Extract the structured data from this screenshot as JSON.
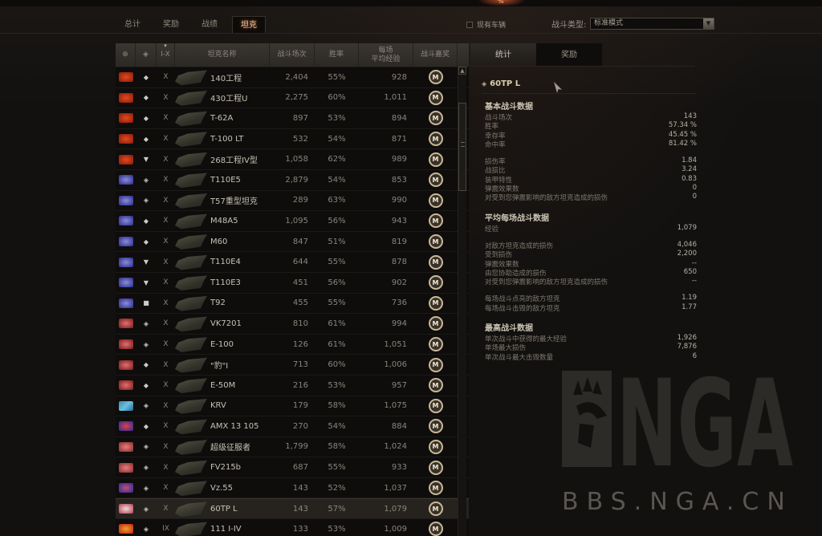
{
  "header": {
    "top_indicator": "%"
  },
  "main_tabs": [
    {
      "label": "总计",
      "active": false
    },
    {
      "label": "奖励",
      "active": false
    },
    {
      "label": "战绩",
      "active": false
    },
    {
      "label": "坦克",
      "active": true
    }
  ],
  "filters": {
    "owned_vehicles_label": "现有车辆",
    "owned_vehicles_checked": false,
    "battle_type_label": "战斗类型:",
    "battle_type_value": "标准模式"
  },
  "table": {
    "columns": {
      "nation": "nation-icon",
      "type": "type-icon",
      "tier": "I-X",
      "name": "坦克名称",
      "battles": "战斗场次",
      "win_rate": "胜率",
      "avg_xp_line1": "每场",
      "avg_xp_line2": "平均经验",
      "medal": "战斗嘉奖"
    },
    "rows": [
      {
        "nation": "ussr",
        "type": "◆",
        "tier": "X",
        "name": "140工程",
        "battles": "2,404",
        "win_rate": "55%",
        "avg_xp": "928",
        "medal": "M"
      },
      {
        "nation": "ussr",
        "type": "◆",
        "tier": "X",
        "name": "430工程U",
        "battles": "2,275",
        "win_rate": "60%",
        "avg_xp": "1,011",
        "medal": "M"
      },
      {
        "nation": "ussr",
        "type": "◆",
        "tier": "X",
        "name": "T-62A",
        "battles": "897",
        "win_rate": "53%",
        "avg_xp": "894",
        "medal": "M"
      },
      {
        "nation": "ussr",
        "type": "◆",
        "tier": "X",
        "name": "T-100 LT",
        "battles": "532",
        "win_rate": "54%",
        "avg_xp": "871",
        "medal": "M"
      },
      {
        "nation": "ussr",
        "type": "▼",
        "tier": "X",
        "name": "268工程IV型",
        "battles": "1,058",
        "win_rate": "62%",
        "avg_xp": "989",
        "medal": "M"
      },
      {
        "nation": "usa",
        "type": "◈",
        "tier": "X",
        "name": "T110E5",
        "battles": "2,879",
        "win_rate": "54%",
        "avg_xp": "853",
        "medal": "M"
      },
      {
        "nation": "usa",
        "type": "◈",
        "tier": "X",
        "name": "T57重型坦克",
        "battles": "289",
        "win_rate": "63%",
        "avg_xp": "990",
        "medal": "M"
      },
      {
        "nation": "usa",
        "type": "◆",
        "tier": "X",
        "name": "M48A5",
        "battles": "1,095",
        "win_rate": "56%",
        "avg_xp": "943",
        "medal": "M"
      },
      {
        "nation": "usa",
        "type": "◆",
        "tier": "X",
        "name": "M60",
        "battles": "847",
        "win_rate": "51%",
        "avg_xp": "819",
        "medal": "M"
      },
      {
        "nation": "usa",
        "type": "▼",
        "tier": "X",
        "name": "T110E4",
        "battles": "644",
        "win_rate": "55%",
        "avg_xp": "878",
        "medal": "M"
      },
      {
        "nation": "usa",
        "type": "▼",
        "tier": "X",
        "name": "T110E3",
        "battles": "451",
        "win_rate": "56%",
        "avg_xp": "902",
        "medal": "M"
      },
      {
        "nation": "usa",
        "type": "■",
        "tier": "X",
        "name": "T92",
        "battles": "455",
        "win_rate": "55%",
        "avg_xp": "736",
        "medal": "M"
      },
      {
        "nation": "germany",
        "type": "◈",
        "tier": "X",
        "name": "VK7201",
        "battles": "810",
        "win_rate": "61%",
        "avg_xp": "994",
        "medal": "M"
      },
      {
        "nation": "germany",
        "type": "◈",
        "tier": "X",
        "name": "E-100",
        "battles": "126",
        "win_rate": "61%",
        "avg_xp": "1,051",
        "medal": "M"
      },
      {
        "nation": "germany",
        "type": "◆",
        "tier": "X",
        "name": "\"豹\"I",
        "battles": "713",
        "win_rate": "60%",
        "avg_xp": "1,006",
        "medal": "M"
      },
      {
        "nation": "germany",
        "type": "◆",
        "tier": "X",
        "name": "E-50M",
        "battles": "216",
        "win_rate": "53%",
        "avg_xp": "957",
        "medal": "M"
      },
      {
        "nation": "sweden",
        "type": "◈",
        "tier": "X",
        "name": "KRV",
        "battles": "179",
        "win_rate": "58%",
        "avg_xp": "1,075",
        "medal": "M"
      },
      {
        "nation": "france",
        "type": "◆",
        "tier": "X",
        "name": "AMX 13 105",
        "battles": "270",
        "win_rate": "54%",
        "avg_xp": "884",
        "medal": "M"
      },
      {
        "nation": "uk",
        "type": "◈",
        "tier": "X",
        "name": "超级征服者",
        "battles": "1,799",
        "win_rate": "58%",
        "avg_xp": "1,024",
        "medal": "M"
      },
      {
        "nation": "uk",
        "type": "◈",
        "tier": "X",
        "name": "FV215b",
        "battles": "687",
        "win_rate": "55%",
        "avg_xp": "933",
        "medal": "M"
      },
      {
        "nation": "czech",
        "type": "◈",
        "tier": "X",
        "name": "Vz.55",
        "battles": "143",
        "win_rate": "52%",
        "avg_xp": "1,037",
        "medal": "M"
      },
      {
        "nation": "poland",
        "type": "◈",
        "tier": "X",
        "name": "60TP L",
        "battles": "143",
        "win_rate": "57%",
        "avg_xp": "1,079",
        "medal": "M",
        "selected": true
      },
      {
        "nation": "china",
        "type": "◈",
        "tier": "IX",
        "name": "111 I-IV",
        "battles": "133",
        "win_rate": "53%",
        "avg_xp": "1,009",
        "medal": "M"
      }
    ]
  },
  "stats_panel": {
    "tabs": [
      {
        "label": "统计",
        "active": true
      },
      {
        "label": "奖励",
        "active": false
      }
    ],
    "tank_name": "60TP L",
    "sections": [
      {
        "title": "基本战斗数据",
        "groups": [
          [
            {
              "label": "战斗场次",
              "value": "143"
            },
            {
              "label": "胜率",
              "value": "57.34 %"
            },
            {
              "label": "幸存率",
              "value": "45.45 %"
            },
            {
              "label": "命中率",
              "value": "81.42 %"
            }
          ],
          [
            {
              "label": "损伤率",
              "value": "1.84"
            },
            {
              "label": "战损比",
              "value": "3.24"
            },
            {
              "label": "装甲特性",
              "value": "0.83"
            },
            {
              "label": "弹震效果数",
              "value": "0"
            },
            {
              "label": "对受到您弹震影响的敌方坦克造成的损伤",
              "value": "0"
            }
          ]
        ]
      },
      {
        "title": "平均每场战斗数据",
        "groups": [
          [
            {
              "label": "经验",
              "value": "1,079"
            }
          ],
          [
            {
              "label": "对敌方坦克造成的损伤",
              "value": "4,046"
            },
            {
              "label": "受到损伤",
              "value": "2,200"
            },
            {
              "label": "弹震效果数",
              "value": "--"
            },
            {
              "label": "由您协助造成的损伤",
              "value": "650"
            },
            {
              "label": "对受到您弹震影响的敌方坦克造成的损伤",
              "value": "--"
            }
          ],
          [
            {
              "label": "每场战斗点亮的敌方坦克",
              "value": "1.19"
            },
            {
              "label": "每场战斗击毁的敌方坦克",
              "value": "1.77"
            }
          ]
        ]
      },
      {
        "title": "最高战斗数据",
        "groups": [
          [
            {
              "label": "单次战斗中获得的最大经验",
              "value": "1,926"
            },
            {
              "label": "单场最大损伤",
              "value": "7,876"
            },
            {
              "label": "单次战斗最大击毁数量",
              "value": "6"
            }
          ]
        ]
      }
    ]
  },
  "watermark": {
    "logo_text": "NGA",
    "site_text": "BBS.NGA.CN"
  },
  "colors": {
    "background": "#141210",
    "active_tab_text": "#f0c8a0",
    "selected_row": "#26231f",
    "medal_border": "#c8b89a"
  }
}
